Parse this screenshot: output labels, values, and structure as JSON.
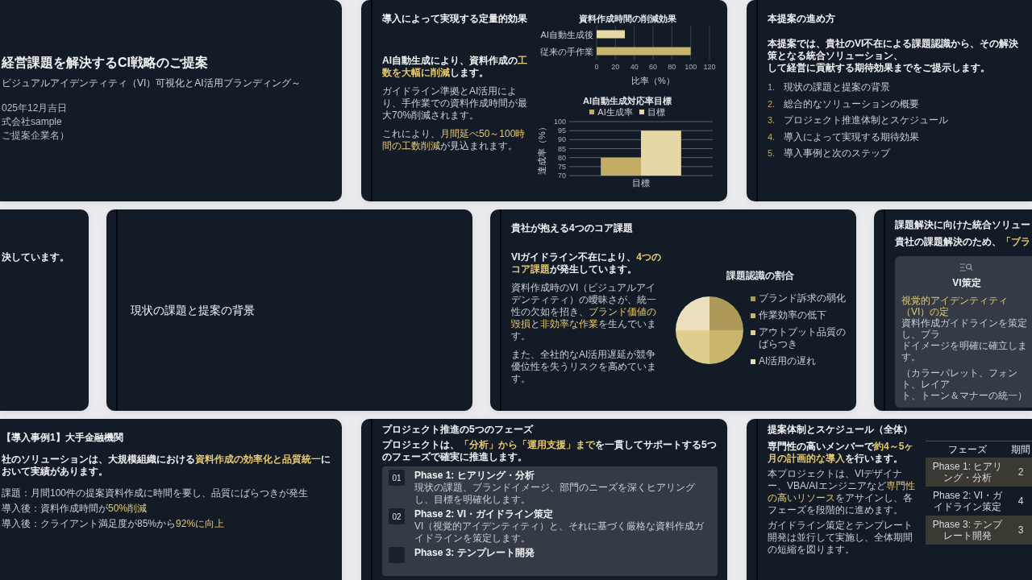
{
  "rows": [
    {
      "slides": [
        {
          "kind": "title",
          "title": "経営課題を解決するCI戦略のご提案",
          "subtitle": "ビジュアルアイデンティティ（VI）可視化とAI活用ブランディング～",
          "meta": [
            "025年12月吉日",
            "式会社sample",
            "ご提案企業名）"
          ]
        },
        {
          "kind": "charts",
          "title": "導入によって実現する定量的効果",
          "lead": [
            {
              "text": "AI自動生成により、資料作成の",
              "highlight": false
            },
            {
              "text": "工数を大幅に削減",
              "highlight": true
            },
            {
              "text": "します。",
              "highlight": false
            }
          ],
          "paragraphs": [
            [
              {
                "text": "ガイドライン準拠とAI活用により、手作業での資料作成時間が最大70%削減されます。",
                "highlight": false
              }
            ],
            [
              {
                "text": "これにより、",
                "highlight": false
              },
              {
                "text": "月間延べ50～100時間の工数削減",
                "highlight": true
              },
              {
                "text": "が見込まれます。",
                "highlight": false
              }
            ]
          ],
          "charts": [
            {
              "chart_data": {
                "type": "bar",
                "orientation": "horizontal",
                "title": "資料作成時間の削減効果",
                "xlabel": "比率（%）",
                "categories": [
                  "AI自動生成後",
                  "従来の手作業"
                ],
                "values": [
                  30,
                  100
                ],
                "colors": [
                  "#e6d8a6",
                  "#c9b46c"
                ],
                "xlim": [
                  0,
                  120
                ],
                "xticks": [
                  0,
                  20,
                  40,
                  60,
                  80,
                  100,
                  120
                ],
                "grid": true
              }
            },
            {
              "chart_data": {
                "type": "bar",
                "title": "AI自動生成対応率目標",
                "ylabel": "達成率（%）",
                "categories": [
                  "目標"
                ],
                "series": [
                  {
                    "name": "AI生成率",
                    "color": "#c3ad64",
                    "values": [
                      80
                    ]
                  },
                  {
                    "name": "目標",
                    "color": "#e6d8a6",
                    "values": [
                      95
                    ]
                  }
                ],
                "ylim": [
                  70,
                  100
                ],
                "yticks": [
                  70,
                  75,
                  80,
                  85,
                  90,
                  95,
                  100
                ],
                "grid": true,
                "legend": "top"
              }
            }
          ]
        },
        {
          "kind": "agenda",
          "title": "本提案の進め方",
          "lead_lines": [
            "本提案では、貴社のVI不在による課題認識から、その解決策となる統合ソリューション、",
            "して経営に貢献する期待効果までをご提示します。"
          ],
          "items": [
            {
              "number": "1.",
              "text": "現状の課題と提案の背景"
            },
            {
              "number": "2.",
              "text": "総合的なソリューションの概要"
            },
            {
              "number": "3.",
              "text": "プロジェクト推進体制とスケジュール"
            },
            {
              "number": "4.",
              "text": "導入によって実現する期待効果"
            },
            {
              "number": "5.",
              "text": "導入事例と次のステップ"
            }
          ]
        }
      ]
    },
    {
      "slides": [
        {
          "kind": "fragment",
          "text": "決しています。"
        },
        {
          "kind": "section",
          "title": "現状の課題と提案の背景"
        },
        {
          "kind": "pie",
          "title": "貴社が抱える4つのコア課題",
          "lead": [
            {
              "text": "VIガイドライン不在により、",
              "highlight": false
            },
            {
              "text": "4つのコア課題",
              "highlight": true
            },
            {
              "text": "が発生しています。",
              "highlight": false
            }
          ],
          "paragraphs": [
            [
              {
                "text": "資料作成時のVI（ビジュアルアイデンティティ）の曖昧さが、統一性の欠如を招き、",
                "highlight": false
              },
              {
                "text": "ブランド価値の毀損",
                "highlight": true
              },
              {
                "text": "と",
                "highlight": false
              },
              {
                "text": "非効率な作業",
                "highlight": true
              },
              {
                "text": "を生んでいます。",
                "highlight": false
              }
            ],
            [
              {
                "text": "また、全社的なAI活用遅延が競争優位性を失うリスクを高めています。",
                "highlight": false
              }
            ]
          ],
          "pie": {
            "title": "課題認識の割合",
            "slices": [
              {
                "label": "ブランド訴求の弱化",
                "color": "#ad9a5b"
              },
              {
                "label": "作業効率の低下",
                "color": "#c9b56b"
              },
              {
                "label": "アウトプット品質のばらつき",
                "color": "#dfcd90"
              },
              {
                "label": "AI活用の遅れ",
                "color": "#ebdfbd"
              }
            ]
          }
        },
        {
          "kind": "solution",
          "title": "課題解決に向けた統合ソリュー",
          "lead": [
            {
              "text": "貴社の課題解決のため、",
              "highlight": false
            },
            {
              "text": "「ブラ",
              "highlight": true
            }
          ],
          "card": {
            "title": "VI策定",
            "paragraphs": [
              {
                "lines": [
                  [
                    {
                      "text": "視覚的アイデンティティ（VI）の定",
                      "highlight": true
                    }
                  ],
                  [
                    {
                      "text": "資料作成ガイドラインを策定し、ブラ",
                      "highlight": false
                    }
                  ],
                  [
                    {
                      "text": "ドイメージを明確に確立します。",
                      "highlight": false
                    }
                  ]
                ]
              },
              {
                "lines": [
                  [
                    {
                      "text": "（カラーパレット、フォント、レイア",
                      "highlight": false
                    }
                  ],
                  [
                    {
                      "text": "ト、トーン＆マナーの統一）",
                      "highlight": false
                    }
                  ]
                ]
              }
            ]
          }
        }
      ]
    },
    {
      "slides": [
        {
          "kind": "case",
          "title": "【導入事例1】大手金融機関",
          "lead": [
            {
              "text": "社のソリューションは、大規模組織における",
              "highlight": false
            },
            {
              "text": "資料作成の効率化と品質統一",
              "highlight": true
            },
            {
              "text": "において実績があります。",
              "highlight": false
            }
          ],
          "bullets": [
            [
              {
                "text": "課題：月間100件の提案資料作成に時間を要し、品質にばらつきが発生",
                "highlight": false
              }
            ],
            [
              {
                "text": "導入後：資料作成時間が",
                "highlight": false
              },
              {
                "text": "50%削減",
                "highlight": true
              }
            ],
            [
              {
                "text": "導入後：クライアント満足度が85%から",
                "highlight": false
              },
              {
                "text": "92%に向上",
                "highlight": true
              }
            ]
          ]
        },
        {
          "kind": "phases",
          "title": "プロジェクト推進の5つのフェーズ",
          "lead": [
            {
              "text": "プロジェクトは、",
              "highlight": false
            },
            {
              "text": "「分析」から「運用支援」まで",
              "highlight": true
            },
            {
              "text": "を一貫してサポートする5つのフェーズで確実に推進します。",
              "highlight": false
            }
          ],
          "phases": [
            {
              "number": "01",
              "title": "Phase 1: ヒアリング・分析",
              "description": "現状の課題、ブランドイメージ、部門のニーズを深くヒアリングし、目標を明確化します。"
            },
            {
              "number": "02",
              "title": "Phase 2: VI・ガイドライン策定",
              "description": "VI（視覚的アイデンティティ）と、それに基づく厳格な資料作成ガイドラインを策定します。"
            },
            {
              "title": "Phase 3: テンプレート開発"
            }
          ]
        },
        {
          "kind": "schedule",
          "title": "提案体制とスケジュール（全体）",
          "lead": [
            {
              "text": "専門性の高いメンバーで",
              "highlight": false
            },
            {
              "text": "約4～5ヶ月の計画的な導入",
              "highlight": true
            },
            {
              "text": "を行います。",
              "highlight": false
            }
          ],
          "paragraphs": [
            [
              {
                "text": "本プロジェクトは、VIデザイナー、VBA/AIエンジニアなど",
                "highlight": false
              },
              {
                "text": "専門性の高いリソース",
                "highlight": true
              },
              {
                "text": "をアサインし、各フェーズを段階的に進めます。",
                "highlight": false
              }
            ],
            [
              {
                "text": "ガイドライン策定とテンプレート開発は並行して実施し、全体期間の短縮を図ります。",
                "highlight": false
              }
            ]
          ],
          "table": {
            "columns": [
              "フェーズ",
              "期間"
            ],
            "rows": [
              [
                "Phase 1: ヒアリング・分析",
                "2"
              ],
              [
                "Phase 2: VI・ガイドライン策定",
                "4"
              ],
              [
                "Phase 3: テンプレート開発",
                "3"
              ]
            ]
          }
        }
      ]
    }
  ]
}
